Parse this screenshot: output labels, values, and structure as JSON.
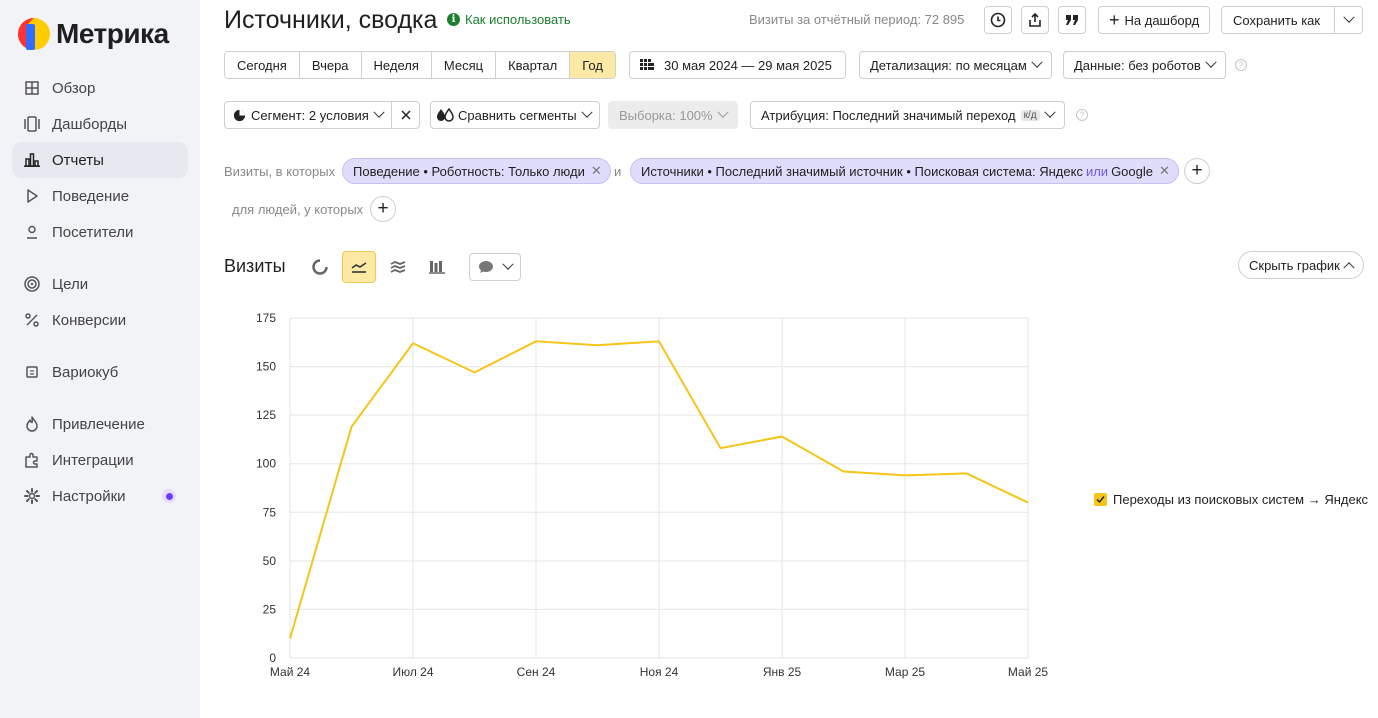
{
  "sidebar": {
    "logo": "Метрика",
    "items": [
      {
        "label": "Обзор",
        "icon": "grid-icon"
      },
      {
        "label": "Дашборды",
        "icon": "dashboard-icon"
      },
      {
        "label": "Отчеты",
        "icon": "bar-chart-icon",
        "active": true
      },
      {
        "label": "Поведение",
        "icon": "play-icon"
      },
      {
        "label": "Посетители",
        "icon": "user-icon"
      },
      {
        "label": "Цели",
        "icon": "target-icon"
      },
      {
        "label": "Конверсии",
        "icon": "percent-icon"
      },
      {
        "label": "Вариокуб",
        "icon": "cube-icon"
      },
      {
        "label": "Привлечение",
        "icon": "flame-icon"
      },
      {
        "label": "Интеграции",
        "icon": "puzzle-icon"
      },
      {
        "label": "Настройки",
        "icon": "gear-icon"
      }
    ]
  },
  "header": {
    "title": "Источники, сводка",
    "howto": "Как использовать",
    "visits_total": "Визиты за отчётный период: 72 895",
    "to_dashboard": "На дашборд",
    "save_as": "Сохранить как"
  },
  "periods": [
    "Сегодня",
    "Вчера",
    "Неделя",
    "Месяц",
    "Квартал",
    "Год"
  ],
  "active_period": "Год",
  "date_range": "30 мая 2024 — 29 мая 2025",
  "detail": "Детализация: по месяцам",
  "data_mode": "Данные: без роботов",
  "segment": "Сегмент: 2 условия",
  "compare": "Сравнить сегменты",
  "sample": "Выборка: 100%",
  "attribution": "Атрибуция: Последний значимый переход",
  "attribution_badge": "к/д",
  "filters": {
    "visits_label": "Визиты, в которых",
    "chip1": "Поведение • Роботность: Только люди",
    "and": "и",
    "chip2_a": "Источники • Последний значимый источник • Поисковая система: Яндекс",
    "chip2_or": "или",
    "chip2_b": "Google",
    "people_label": "для людей, у которых"
  },
  "chart_section": {
    "title": "Визиты",
    "hide_chart": "Скрыть график"
  },
  "colors": {
    "accent": "#f5c518",
    "active_bg": "#fde9a6",
    "chip_bg": "#e0dcfb"
  },
  "chart_data": {
    "type": "line",
    "x": [
      "Май 24",
      "Июн 24",
      "Июл 24",
      "Авг 24",
      "Сен 24",
      "Окт 24",
      "Ноя 24",
      "Дек 24",
      "Янв 25",
      "Фев 25",
      "Мар 25",
      "Апр 25",
      "Май 25"
    ],
    "x_tick_labels": [
      "Май 24",
      "Июл 24",
      "Сен 24",
      "Ноя 24",
      "Янв 25",
      "Мар 25",
      "Май 25"
    ],
    "series": [
      {
        "name": "Переходы из поисковых систем → Яндекс",
        "color": "#f5c518",
        "values": [
          10,
          119,
          162,
          147,
          163,
          161,
          163,
          108,
          114,
          96,
          94,
          95,
          80
        ]
      }
    ],
    "y_ticks": [
      0,
      25,
      50,
      75,
      100,
      125,
      150,
      175
    ],
    "ylim": [
      0,
      175
    ],
    "grid": true,
    "legend_position": "right"
  }
}
